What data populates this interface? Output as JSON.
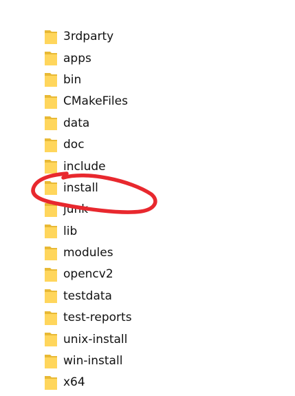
{
  "folders": [
    {
      "name": "3rdparty"
    },
    {
      "name": "apps"
    },
    {
      "name": "bin"
    },
    {
      "name": "CMakeFiles"
    },
    {
      "name": "data"
    },
    {
      "name": "doc"
    },
    {
      "name": "include"
    },
    {
      "name": "install"
    },
    {
      "name": "junk"
    },
    {
      "name": "lib"
    },
    {
      "name": "modules"
    },
    {
      "name": "opencv2"
    },
    {
      "name": "testdata"
    },
    {
      "name": "test-reports"
    },
    {
      "name": "unix-install"
    },
    {
      "name": "win-install"
    },
    {
      "name": "x64"
    }
  ],
  "icon": "folder-icon",
  "colors": {
    "folder_front": "#FFD65C",
    "folder_back": "#E8B935",
    "annotation": "#E8282E"
  },
  "annotation": {
    "type": "hand-drawn-circle",
    "highlighted_folder": "install"
  }
}
